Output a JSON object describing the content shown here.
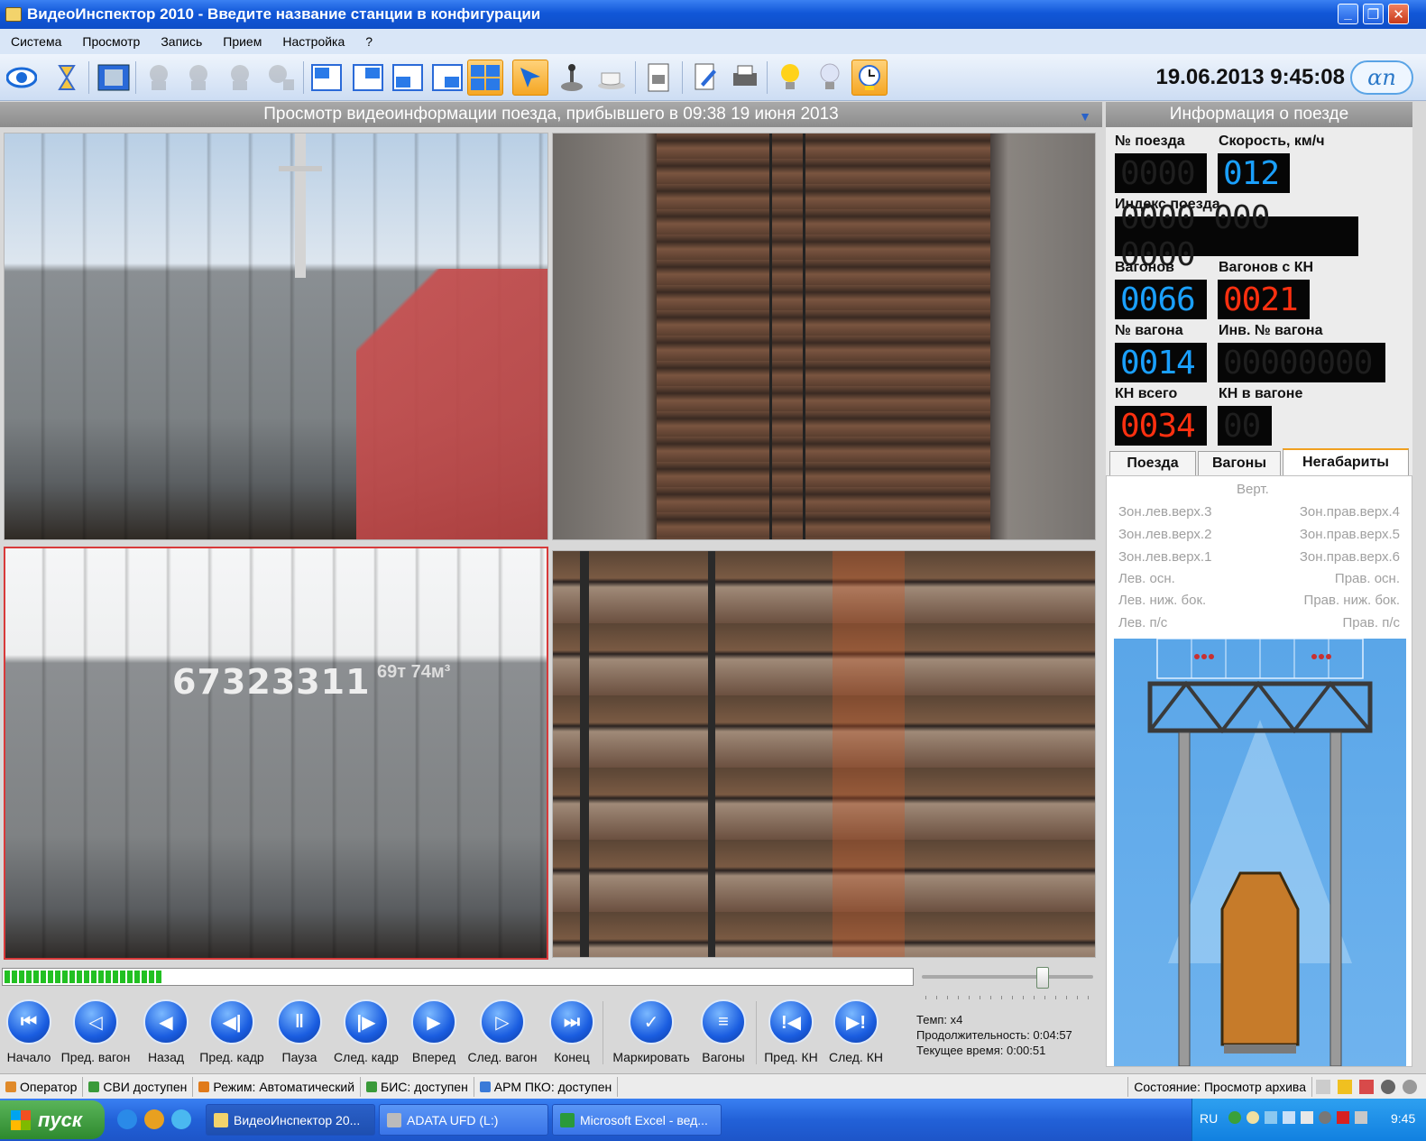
{
  "window": {
    "title": "ВидеоИнспектор 2010 - Введите название станции в конфигурации"
  },
  "menu": [
    "Система",
    "Просмотр",
    "Запись",
    "Прием",
    "Настройка",
    "?"
  ],
  "header": {
    "datetime": "19.06.2013 9:45:08",
    "logo_text": "αn"
  },
  "toolbar": {
    "icons": [
      "eye-icon",
      "hourglass-icon",
      "film-icon",
      "camera1-icon",
      "camera2-icon",
      "camera3-icon",
      "camera-add-icon",
      "layout1-icon",
      "layout2-icon",
      "layout3-icon",
      "layout4-icon",
      "layout-grid-icon",
      "pointer-icon",
      "joystick-icon",
      "coffee-icon",
      "document-icon",
      "edit-icon",
      "printer-icon",
      "bulb-on-icon",
      "bulb-off-icon",
      "clock-icon"
    ],
    "active": [
      "layout-grid-icon",
      "pointer-icon",
      "clock-icon"
    ]
  },
  "viewer": {
    "title": "Просмотр видеоинформации поезда, прибывшего в 09:38 19 июня 2013",
    "car_number": "67323311",
    "car_label": "69ᴛ 74м³",
    "progress_percent": 17.5,
    "slider_percent": 72
  },
  "info": {
    "title": "Информация о поезде",
    "train_no_label": "№ поезда",
    "train_no": "0000",
    "speed_label": "Скорость, км/ч",
    "speed": "012",
    "index_label": "Индекс поезда",
    "index": "0000 000 0000",
    "wagons_label": "Вагонов",
    "wagons": "0066",
    "wagons_kn_label": "Вагонов с КН",
    "wagons_kn": "0021",
    "wagon_no_label": "№ вагона",
    "wagon_no": "0014",
    "inv_label": "Инв. № вагона",
    "inv": "00000000",
    "kn_total_label": "КН всего",
    "kn_total": "0034",
    "kn_wagon_label": "КН в вагоне",
    "kn_wagon": "00"
  },
  "tabs": [
    "Поезда",
    "Вагоны",
    "Негабариты"
  ],
  "gabarit": {
    "top": "Верт.",
    "left": [
      "Зон.лев.верх.3",
      "Зон.лев.верх.2",
      "Зон.лев.верх.1",
      "Лев. осн.",
      "Лев. ниж. бок.",
      "Лев. п/с"
    ],
    "right": [
      "Зон.прав.верх.4",
      "Зон.прав.верх.5",
      "Зон.прав.верх.6",
      "Прав. осн.",
      "Прав. ниж. бок.",
      "Прав. п/с"
    ]
  },
  "controls": [
    {
      "label": "Начало",
      "glyph": "⏮"
    },
    {
      "label": "Пред. вагон",
      "glyph": "◁"
    },
    {
      "label": "Назад",
      "glyph": "◀"
    },
    {
      "label": "Пред. кадр",
      "glyph": "◀|"
    },
    {
      "label": "Пауза",
      "glyph": "‖"
    },
    {
      "label": "След. кадр",
      "glyph": "|▶"
    },
    {
      "label": "Вперед",
      "glyph": "▶"
    },
    {
      "label": "След. вагон",
      "glyph": "▷"
    },
    {
      "label": "Конец",
      "glyph": "⏭"
    },
    {
      "label": "Маркировать",
      "glyph": "✓"
    },
    {
      "label": "Вагоны",
      "glyph": "≡"
    },
    {
      "label": "Пред. КН",
      "glyph": "!◀"
    },
    {
      "label": "След. КН",
      "glyph": "▶!"
    }
  ],
  "stats": {
    "tempo": "Темп: x4",
    "duration": "Продолжительность: 0:04:57",
    "current": "Текущее время: 0:00:51"
  },
  "status": [
    {
      "text": "Оператор",
      "color": "#e08a2a"
    },
    {
      "text": "СВИ доступен",
      "color": "#3a9a3a"
    },
    {
      "text": "Режим: Автоматический",
      "color": "#e07a1a"
    },
    {
      "text": "БИС: доступен",
      "color": "#3a9a3a"
    },
    {
      "text": "АРМ ПКО: доступен",
      "color": "#3a7ad8"
    }
  ],
  "state": "Состояние: Просмотр архива",
  "taskbar": {
    "start": "пуск",
    "tasks": [
      "ВидеоИнспектор 20...",
      "ADATA UFD (L:)",
      "Microsoft Excel - вед..."
    ],
    "lang": "RU",
    "clock": "9:45"
  }
}
